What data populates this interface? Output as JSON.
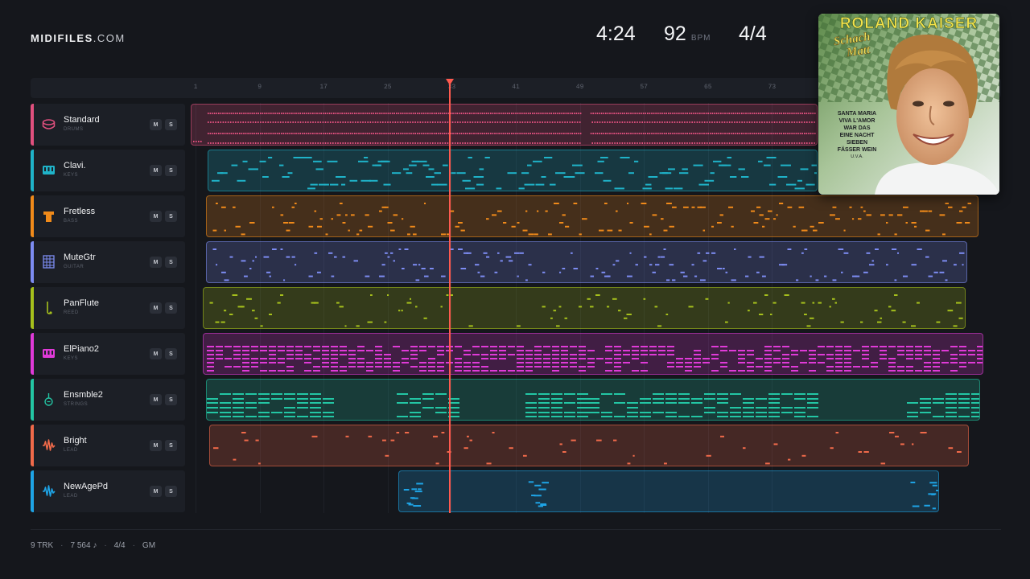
{
  "brand": {
    "name": "MIDIFILES",
    "domain": ".COM"
  },
  "transport": {
    "time": "4:24",
    "tempo": "92",
    "tempo_unit": "BPM",
    "signature": "4/4",
    "playhead_bar": 33
  },
  "ruler": {
    "ticks": [
      "1",
      "9",
      "17",
      "25",
      "33",
      "41",
      "49",
      "57",
      "65",
      "73"
    ]
  },
  "tracks": [
    {
      "name": "Standard",
      "category": "DRUMS",
      "color": "#e0507e",
      "icon": "drum-icon",
      "mute": "M",
      "solo": "S"
    },
    {
      "name": "Clavi.",
      "category": "KEYS",
      "color": "#1fb3c9",
      "icon": "keyboard-icon",
      "mute": "M",
      "solo": "S"
    },
    {
      "name": "Fretless",
      "category": "BASS",
      "color": "#f08a1a",
      "icon": "bass-amp-icon",
      "mute": "M",
      "solo": "S"
    },
    {
      "name": "MuteGtr",
      "category": "GUITAR",
      "color": "#7d8cf2",
      "icon": "guitar-fretboard-icon",
      "mute": "M",
      "solo": "S"
    },
    {
      "name": "PanFlute",
      "category": "REED",
      "color": "#a6c01c",
      "icon": "reed-icon",
      "mute": "M",
      "solo": "S"
    },
    {
      "name": "ElPiano2",
      "category": "KEYS",
      "color": "#e03ad8",
      "icon": "keyboard-icon",
      "mute": "M",
      "solo": "S"
    },
    {
      "name": "Ensmble2",
      "category": "STRINGS",
      "color": "#23c6a4",
      "icon": "violin-icon",
      "mute": "M",
      "solo": "S"
    },
    {
      "name": "Bright",
      "category": "LEAD",
      "color": "#f06a4a",
      "icon": "waveform-icon",
      "mute": "M",
      "solo": "S"
    },
    {
      "name": "NewAgePd",
      "category": "LEAD",
      "color": "#1ea4e6",
      "icon": "waveform-icon",
      "mute": "M",
      "solo": "S"
    }
  ],
  "cover": {
    "artist": "ROLAND KAISER",
    "album_line1": "Schach",
    "album_line2": "Matt",
    "songs": [
      "SANTA MARIA",
      "VIVA L'AMOR",
      "WAR DAS",
      "EINE NACHT",
      "SIEBEN",
      "FÄSSER WEIN"
    ],
    "extra": "U.V.A."
  },
  "footer": {
    "tracks": "9 TRK",
    "notes": "7 564 ♪",
    "signature": "4/4",
    "standard": "GM"
  }
}
